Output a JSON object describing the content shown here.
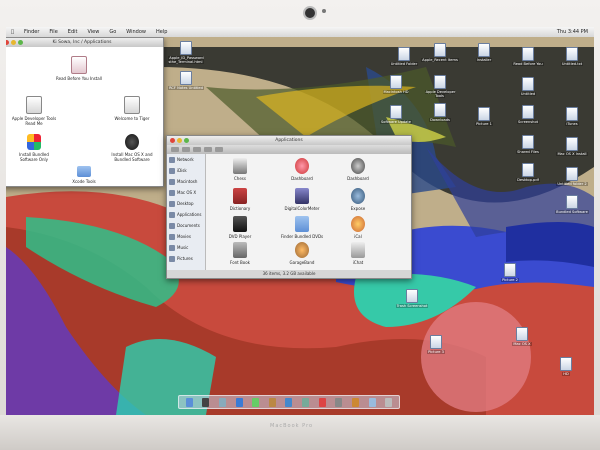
{
  "menubar": {
    "items": [
      "Finder",
      "File",
      "Edit",
      "View",
      "Go",
      "Window",
      "Help"
    ],
    "clock": "Thu 3:44 PM"
  },
  "window_main": {
    "title": "Ki Sowa, Inc / Applications",
    "items": [
      {
        "label": "Read Before You Install",
        "icon": "document-icon"
      },
      {
        "label": "Apple Developer Tools Read Me",
        "icon": "document-icon"
      },
      {
        "label": "Welcome to Tiger",
        "icon": "document-icon"
      },
      {
        "label": "Install Bundled Software Only",
        "icon": "installer-icon"
      },
      {
        "label": "Install Mac OS X and Bundled Software",
        "icon": "installer-icon"
      },
      {
        "label": "Xcode Tools",
        "icon": "folder-icon"
      }
    ]
  },
  "window_apps": {
    "title": "Applications",
    "status": "36 items, 3.2 GB available",
    "sidebar": [
      "Network",
      "iDisk",
      "Macintosh",
      "Mac OS X",
      "Desktop",
      "Applications",
      "Documents",
      "Movies",
      "Music",
      "Pictures"
    ],
    "items": [
      {
        "label": "Chess",
        "icon": "chess-icon"
      },
      {
        "label": "Dashboard",
        "icon": "dashboard-icon"
      },
      {
        "label": "Dashboard",
        "icon": "dashboard-icon"
      },
      {
        "label": "Dictionary",
        "icon": "dictionary-icon"
      },
      {
        "label": "DigitalColorMeter",
        "icon": "color-meter-icon"
      },
      {
        "label": "Expose",
        "icon": "expose-icon"
      },
      {
        "label": "DVD Player",
        "icon": "dvd-icon"
      },
      {
        "label": "Finder Bundled DVDs",
        "icon": "folder-icon"
      },
      {
        "label": "iCal",
        "icon": "ical-icon"
      },
      {
        "label": "Font Book",
        "icon": "fontbook-icon"
      },
      {
        "label": "GarageBand",
        "icon": "guitar-icon"
      },
      {
        "label": "iChat",
        "icon": "ichat-icon"
      }
    ]
  },
  "desktop_icons": [
    {
      "label": "Apple_ID_Password sthe_Terminal.html"
    },
    {
      "label": "RCF Notes Untitled"
    },
    {
      "label": "Untitled Folder"
    },
    {
      "label": "Apple_Recent Items"
    },
    {
      "label": "Installer"
    },
    {
      "label": "Read Before You"
    },
    {
      "label": "Untitled.txt"
    },
    {
      "label": "Macintosh HD"
    },
    {
      "label": "Apple Developer Tools"
    },
    {
      "label": "Untitled"
    },
    {
      "label": "Software Update"
    },
    {
      "label": "Downloads"
    },
    {
      "label": "Picture 1"
    },
    {
      "label": "Screenshot"
    },
    {
      "label": "iTunes"
    },
    {
      "label": "Shared Files"
    },
    {
      "label": "Mac OS X Install"
    },
    {
      "label": "Desktop.pdf"
    },
    {
      "label": "Untitled folder 2"
    },
    {
      "label": "Bundled Software"
    },
    {
      "label": "Picture 2"
    },
    {
      "label": "Trash Screenshot"
    },
    {
      "label": "Picture 3"
    },
    {
      "label": "Mac OS X"
    },
    {
      "label": "HD"
    }
  ],
  "bezel": {
    "brand": "MacBook Pro"
  },
  "colors": {
    "menubar": "#e8e8e8",
    "window_bg": "#ffffff",
    "dock": "#c8d2e6"
  }
}
